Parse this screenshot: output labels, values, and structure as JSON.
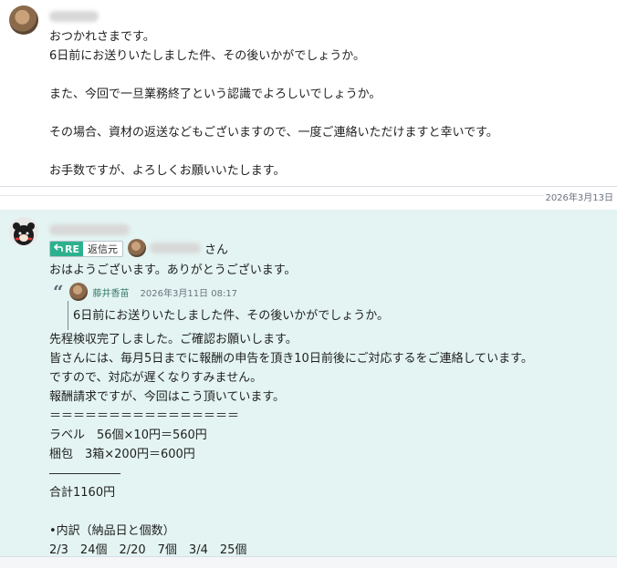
{
  "message1": {
    "lines": [
      "おつかれさまです。",
      "6日前にお送りいたしました件、その後いかがでしょうか。",
      "",
      "また、今回で一旦業務終了という認識でよろしいでしょうか。",
      "",
      "その場合、資材の返送などもございますので、一度ご連絡いただけますと幸いです。",
      "",
      "お手数ですが、よろしくお願いいたします。"
    ]
  },
  "date_separator": "2026年3月13日",
  "message2": {
    "re_label": "RE",
    "re_source": "返信元",
    "san": "さん",
    "greeting": "おはようございます。ありがとうございます。",
    "quote": {
      "mark": "“",
      "name": "藤井香苗",
      "time": "2026年3月11日 08:17",
      "text": "6日前にお送りいたしました件、その後いかがでしょうか。"
    },
    "body_lines": [
      "先程検収完了しました。ご確認お願いします。",
      "皆さんには、毎月5日までに報酬の申告を頂き10日前後にご対応するをご連絡しています。",
      "ですので、対応が遅くなりすみません。",
      "報酬請求ですが、今回はこう頂いています。",
      "＝＝＝＝＝＝＝＝＝＝＝＝＝＝＝＝",
      "ラベル　56個×10円＝560円",
      "梱包　3箱×200円＝600円",
      "――――――",
      "合計1160円",
      "",
      "•内訳（納品日と個数）",
      "2/3　24個　2/20　7個　3/4　25個"
    ]
  },
  "colors": {
    "reply_bg": "#e3f4f2",
    "re_green": "#2bb18e"
  }
}
